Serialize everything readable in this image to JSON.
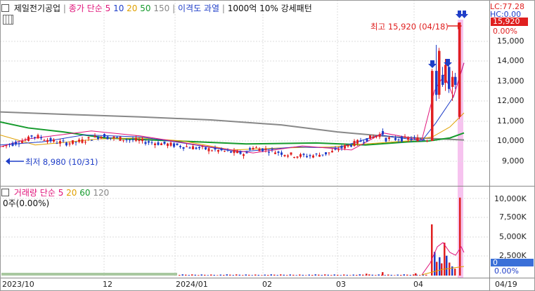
{
  "price_legend": {
    "stock_name": "제일전기공업",
    "ma_prefix": "종가 단순",
    "ma_periods": [
      {
        "label": "5",
        "color": "#e0147a"
      },
      {
        "label": "10",
        "color": "#1f3ec8"
      },
      {
        "label": "20",
        "color": "#e0a000"
      },
      {
        "label": "50",
        "color": "#159a2c"
      },
      {
        "label": "150",
        "color": "#888888"
      }
    ],
    "disparity": "이격도 과열",
    "surge_pattern": "1000억 10% 강세패턴"
  },
  "status": {
    "lc": "LC:77.28",
    "hc": "HC:0.00"
  },
  "current_price": {
    "price": "15,920",
    "change": "0.00%"
  },
  "annotations": {
    "high": "최고 15,920 (04/18)",
    "low": "최저 8,980 (10/31)"
  },
  "volume_legend": {
    "title": "거래량",
    "ma_prefix": "단순",
    "ma_periods": [
      {
        "label": "5",
        "color": "#e0147a"
      },
      {
        "label": "20",
        "color": "#e0a000"
      },
      {
        "label": "60",
        "color": "#159a2c"
      },
      {
        "label": "120",
        "color": "#888888"
      }
    ],
    "current_volume": "0주(0.00%)",
    "current_label": "0"
  },
  "price_axis": [
    "15,000",
    "14,000",
    "13,000",
    "12,000",
    "11,000",
    "10,000",
    "9,000"
  ],
  "volume_axis": [
    "10,000K",
    "7,500K",
    "5,000K",
    "2,500K",
    "0.00%"
  ],
  "date_axis": [
    "2023/10",
    "12",
    "2024/01",
    "02",
    "03",
    "04",
    "04/19"
  ],
  "colors": {
    "up": "#e02020",
    "down": "#1f3ec8",
    "highlight": "#f2b0e8",
    "current_tag": "#e02020",
    "volume_tag": "#3a6fd8"
  }
}
